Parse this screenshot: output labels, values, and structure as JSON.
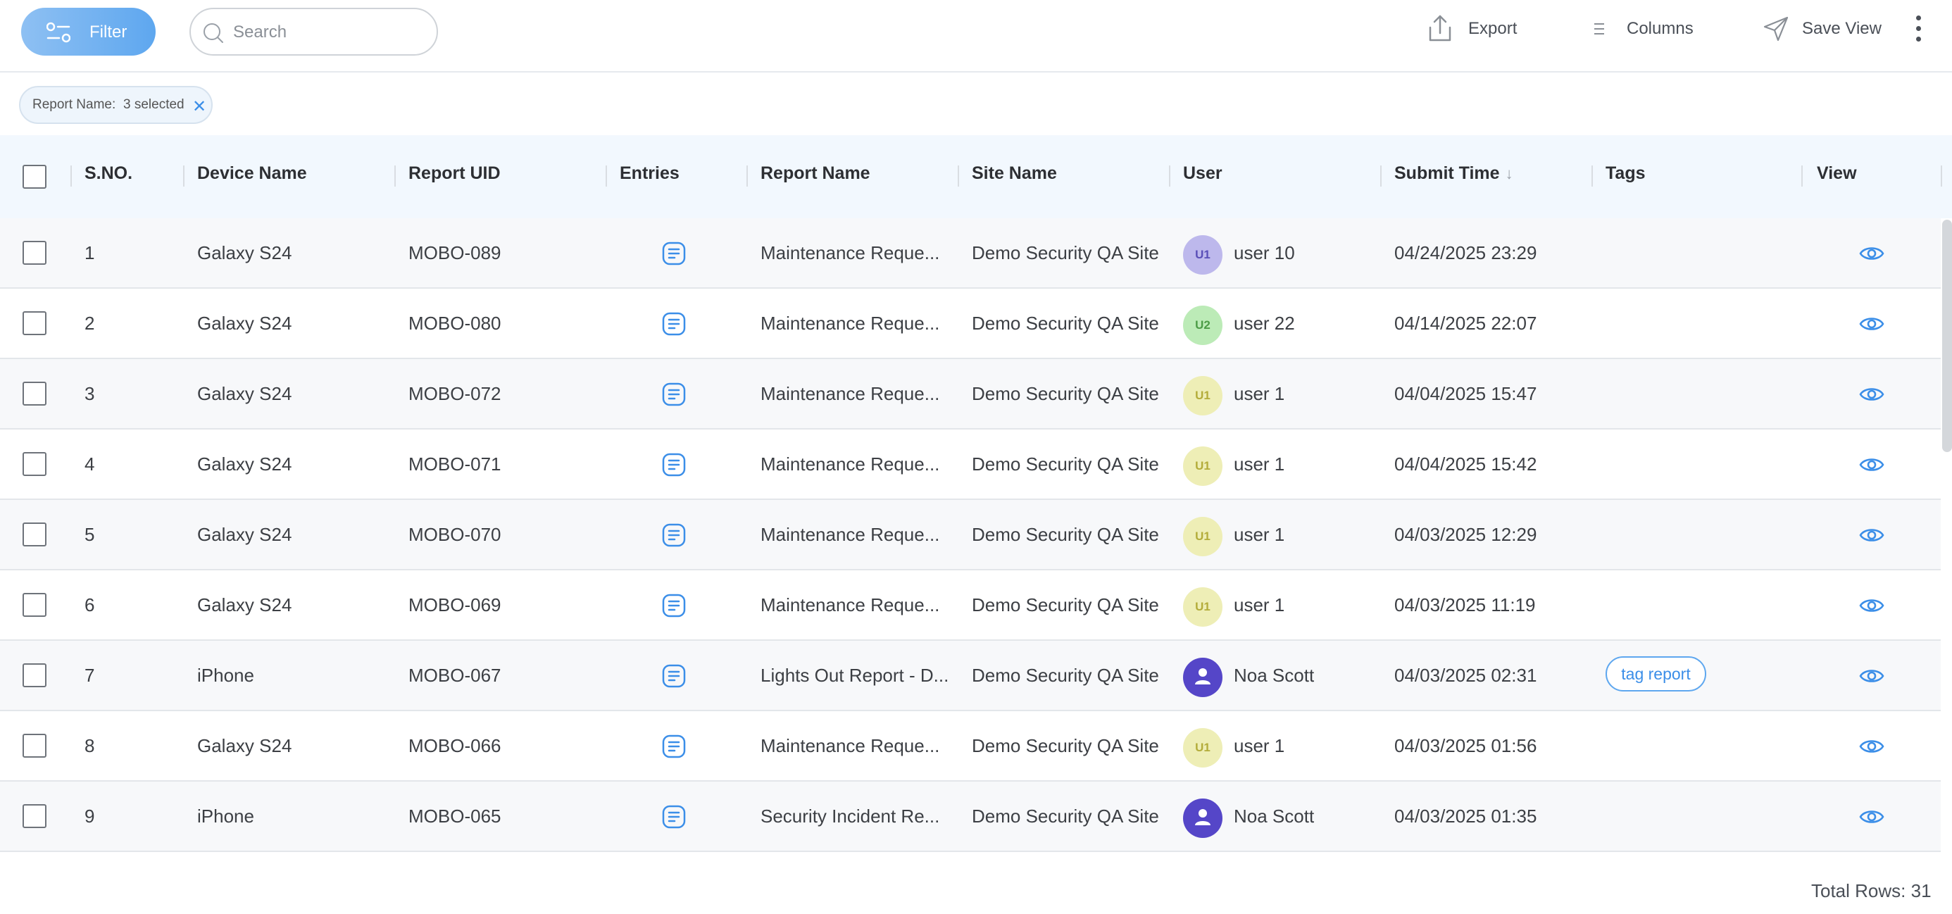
{
  "toolbar": {
    "filter_label": "Filter",
    "search_placeholder": "Search",
    "export_label": "Export",
    "columns_label": "Columns",
    "save_view_label": "Save View"
  },
  "active_filter": {
    "label": "Report Name:",
    "value": "3 selected"
  },
  "table": {
    "columns": [
      "S.NO.",
      "Device Name",
      "Report UID",
      "Entries",
      "Report Name",
      "Site Name",
      "User",
      "Submit Time",
      "Tags",
      "View"
    ],
    "sorted_column": "Submit Time",
    "sort_direction": "descending",
    "rows": [
      {
        "sno": "1",
        "device": "Galaxy S24",
        "uid": "MOBO-089",
        "report_name": "Maintenance Reque...",
        "site": "Demo Security QA Site",
        "avatar": "U1",
        "avatar_style": "u10",
        "user": "user 10",
        "submit_time": "04/24/2025 23:29",
        "tag": ""
      },
      {
        "sno": "2",
        "device": "Galaxy S24",
        "uid": "MOBO-080",
        "report_name": "Maintenance Reque...",
        "site": "Demo Security QA Site",
        "avatar": "U2",
        "avatar_style": "u2",
        "user": "user 22",
        "submit_time": "04/14/2025 22:07",
        "tag": ""
      },
      {
        "sno": "3",
        "device": "Galaxy S24",
        "uid": "MOBO-072",
        "report_name": "Maintenance Reque...",
        "site": "Demo Security QA Site",
        "avatar": "U1",
        "avatar_style": "u1",
        "user": "user 1",
        "submit_time": "04/04/2025 15:47",
        "tag": ""
      },
      {
        "sno": "4",
        "device": "Galaxy S24",
        "uid": "MOBO-071",
        "report_name": "Maintenance Reque...",
        "site": "Demo Security QA Site",
        "avatar": "U1",
        "avatar_style": "u1",
        "user": "user 1",
        "submit_time": "04/04/2025 15:42",
        "tag": ""
      },
      {
        "sno": "5",
        "device": "Galaxy S24",
        "uid": "MOBO-070",
        "report_name": "Maintenance Reque...",
        "site": "Demo Security QA Site",
        "avatar": "U1",
        "avatar_style": "u1",
        "user": "user 1",
        "submit_time": "04/03/2025 12:29",
        "tag": ""
      },
      {
        "sno": "6",
        "device": "Galaxy S24",
        "uid": "MOBO-069",
        "report_name": "Maintenance Reque...",
        "site": "Demo Security QA Site",
        "avatar": "U1",
        "avatar_style": "u1",
        "user": "user 1",
        "submit_time": "04/03/2025 11:19",
        "tag": ""
      },
      {
        "sno": "7",
        "device": "iPhone",
        "uid": "MOBO-067",
        "report_name": "Lights Out Report - D...",
        "site": "Demo Security QA Site",
        "avatar": "",
        "avatar_style": "person",
        "user": "Noa Scott",
        "submit_time": "04/03/2025 02:31",
        "tag": "tag report"
      },
      {
        "sno": "8",
        "device": "Galaxy S24",
        "uid": "MOBO-066",
        "report_name": "Maintenance Reque...",
        "site": "Demo Security QA Site",
        "avatar": "U1",
        "avatar_style": "u1",
        "user": "user 1",
        "submit_time": "04/03/2025 01:56",
        "tag": ""
      },
      {
        "sno": "9",
        "device": "iPhone",
        "uid": "MOBO-065",
        "report_name": "Security Incident Re...",
        "site": "Demo Security QA Site",
        "avatar": "",
        "avatar_style": "person",
        "user": "Noa Scott",
        "submit_time": "04/03/2025 01:35",
        "tag": ""
      }
    ]
  },
  "footer": {
    "total_rows": "Total Rows: 31"
  },
  "colors": {
    "accent": "#3b8ee8",
    "header_bg": "#f2f8fe",
    "avatar_person": "#5546c8"
  },
  "icons": {
    "filter": "filter-sliders-icon",
    "search": "search-icon",
    "export": "export-icon",
    "columns": "columns-icon",
    "save_view": "send-icon",
    "more": "kebab-menu-icon",
    "entries": "document-lines-icon",
    "view": "eye-icon",
    "person": "person-icon"
  }
}
